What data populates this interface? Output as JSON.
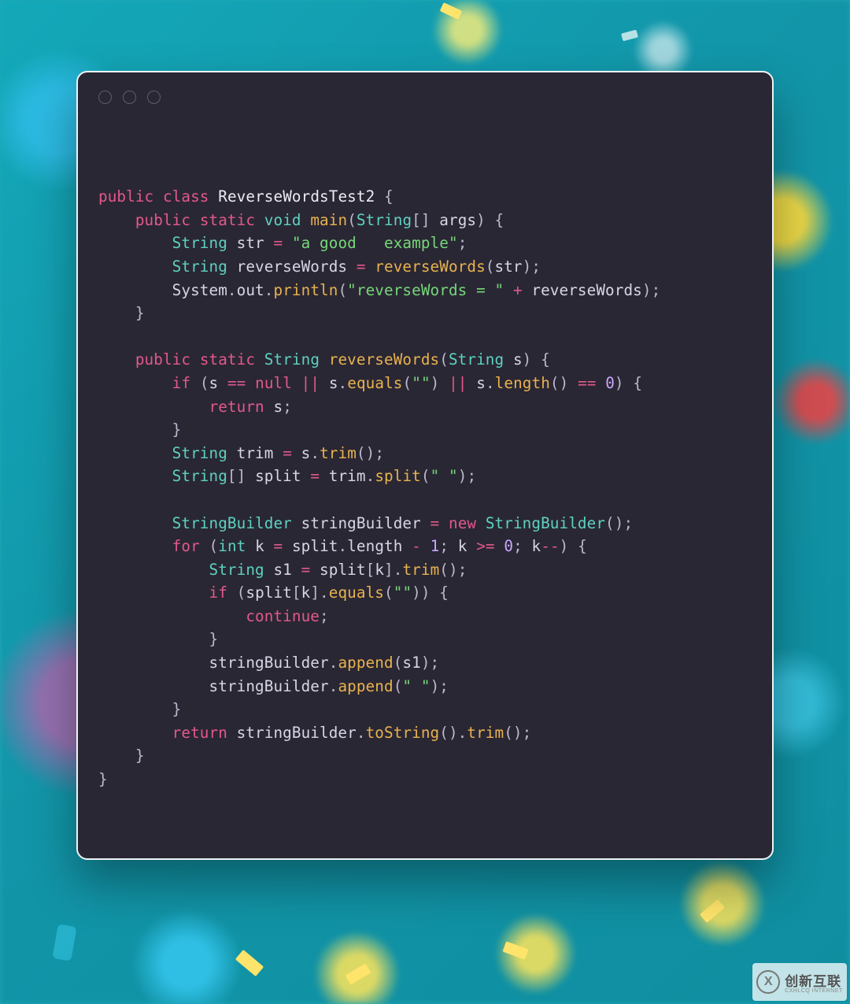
{
  "window": {
    "traffic_lights": 3
  },
  "code": {
    "language": "java",
    "class_name": "ReverseWordsTest2",
    "main_str_literal": "a good   example",
    "println_prefix": "reverseWords = ",
    "empty_str": "",
    "space_str": " ",
    "tokens": {
      "public": "public",
      "class": "class",
      "static": "static",
      "void": "void",
      "String": "String",
      "StringBuilder": "StringBuilder",
      "int": "int",
      "if": "if",
      "for": "for",
      "return": "return",
      "continue": "continue",
      "null": "null",
      "new": "new",
      "main": "main",
      "args": "args",
      "str": "str",
      "reverseWords_var": "reverseWords",
      "reverseWords_fn": "reverseWords",
      "System": "System",
      "out": "out",
      "println": "println",
      "s": "s",
      "equals": "equals",
      "length": "length",
      "trim_var": "trim",
      "trim_fn": "trim",
      "split_var": "split",
      "split_fn": "split",
      "stringBuilder": "stringBuilder",
      "k": "k",
      "s1": "s1",
      "append": "append",
      "toString": "toString",
      "zero": "0",
      "one": "1"
    }
  },
  "watermark": {
    "logo_letter": "X",
    "text": "创新互联",
    "sub": "CXHLCQ INTERNET"
  }
}
